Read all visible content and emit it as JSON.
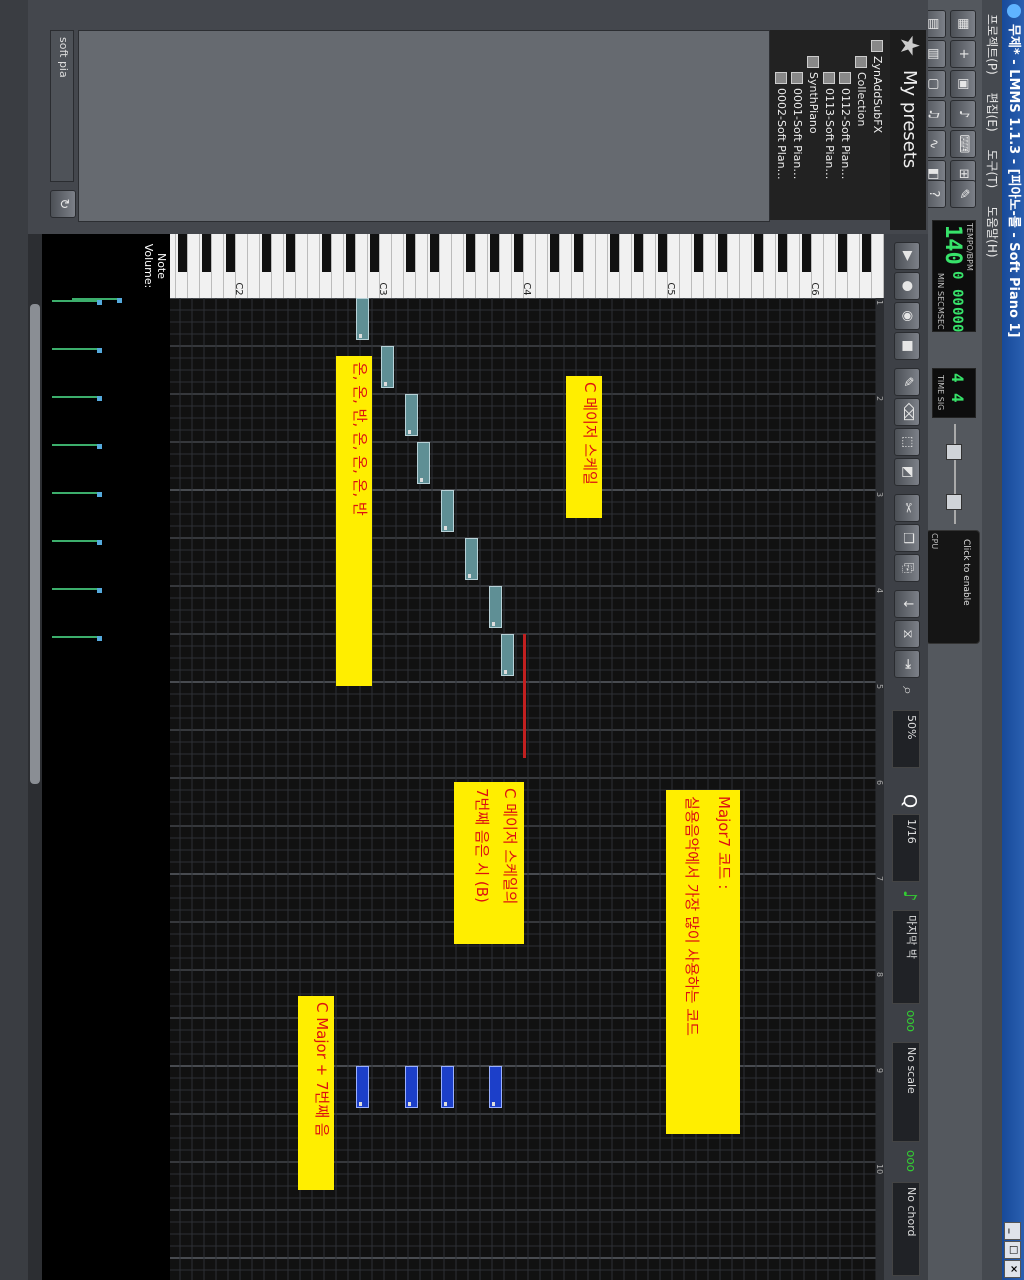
{
  "window": {
    "title": "무제* - LMMS 1.1.3 - [피아노-롤 - Soft Piano 1]",
    "controls": [
      "_",
      "□",
      "×"
    ]
  },
  "menu": [
    "프로젝트(P)",
    "편집(E)",
    "도구(T)",
    "도움말(H)"
  ],
  "transport": {
    "tempo_label": "TEMPO/BPM",
    "tempo": "140",
    "min_label": "MIN",
    "sec_label": "SEC",
    "msec_label": "MSEC",
    "min": "0",
    "sec": "00",
    "msec": "000",
    "timesig_label": "TIME SIG",
    "timesig_num": "4",
    "timesig_den": "4",
    "cpu_label": "CPU",
    "cpu_text": "Click to enable"
  },
  "sidebar": {
    "title": "My presets",
    "search_button": "My presets",
    "tree": [
      {
        "label": "ZynAddSubFX"
      },
      {
        "label": "Collection"
      },
      {
        "label": "0112-Soft Pian…"
      },
      {
        "label": "0113-Soft Pian…"
      },
      {
        "label": "SynthPiano"
      },
      {
        "label": "0001-Soft Pian…"
      },
      {
        "label": "0002-Soft Plan…"
      }
    ],
    "filter_text": "soft pia"
  },
  "piano_roll": {
    "octave_labels": [
      "C2",
      "C3",
      "C4",
      "C5",
      "C6"
    ],
    "bar_numbers": [
      "1",
      "2",
      "3",
      "4",
      "5",
      "6",
      "7",
      "8",
      "9",
      "10"
    ],
    "note_volume_label": "Note\nVolume:",
    "zoom": "50%",
    "quantize": "1/16",
    "note_length": "마지막 박",
    "scale": "No scale",
    "chord": "No chord",
    "annotations": [
      {
        "text": "C 메이저 스케일"
      },
      {
        "text": "온, 온, 반, 온, 온, 온, 반"
      },
      {
        "text": "C 메이저 스케일의"
      },
      {
        "text": "7번째 음은 시 (B)"
      },
      {
        "text": "Major7 코드 :"
      },
      {
        "text": "실용음악에서 가장 많이 사용하는 코드"
      },
      {
        "text": "C Major + 7번째 음"
      }
    ]
  }
}
